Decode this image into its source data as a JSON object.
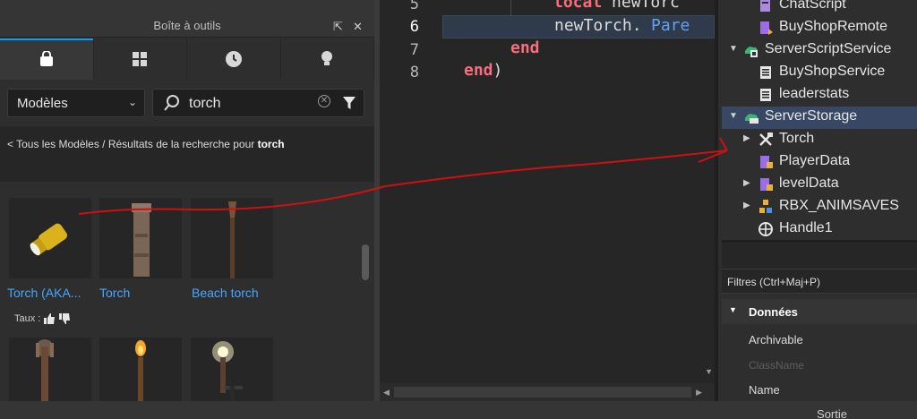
{
  "toolbox": {
    "title": "Boîte à outils",
    "dropdown_value": "Modèles",
    "search_value": "torch",
    "breadcrumb_prefix": "< Tous les Modèles / Résultats de la recherche pour ",
    "breadcrumb_query": "torch",
    "tabs": [
      {
        "name": "marketplace",
        "icon": "bag-icon",
        "active": true
      },
      {
        "name": "inventory",
        "icon": "grid-icon",
        "active": false
      },
      {
        "name": "recent",
        "icon": "clock-icon",
        "active": false
      },
      {
        "name": "creations",
        "icon": "lightbulb-icon",
        "active": false
      }
    ],
    "results": [
      {
        "name": "Torch (AKA..."
      },
      {
        "name": "Torch"
      },
      {
        "name": "Beach torch"
      }
    ],
    "rating_label": "Taux :"
  },
  "editor": {
    "lines": [
      {
        "num": "5"
      },
      {
        "num": "6"
      },
      {
        "num": "7"
      },
      {
        "num": "8"
      }
    ],
    "code": {
      "l5_kw": "local",
      "l5_rest": " newTorc",
      "l6_a": "newTorch.",
      "l6_b": "Pare",
      "l7_kw": "end",
      "l8_kw": "end",
      "l8_rest": ")"
    }
  },
  "explorer": {
    "nodes": [
      {
        "label": "ChatScript",
        "icon": "localscript-icon"
      },
      {
        "label": "BuyShopRemote",
        "icon": "remote-event-icon"
      },
      {
        "label": "ServerScriptService",
        "icon": "service-icon"
      },
      {
        "label": "BuyShopService",
        "icon": "script-icon"
      },
      {
        "label": "leaderstats",
        "icon": "script-icon"
      },
      {
        "label": "ServerStorage",
        "icon": "storage-icon",
        "selected": true
      },
      {
        "label": "Torch",
        "icon": "tool-icon"
      },
      {
        "label": "PlayerData",
        "icon": "module-icon"
      },
      {
        "label": "levelData",
        "icon": "module-icon"
      },
      {
        "label": "RBX_ANIMSAVES",
        "icon": "model-icon"
      },
      {
        "label": "Handle1",
        "icon": "part-icon"
      }
    ],
    "filter_text": "Filtres (Ctrl+Maj+P)",
    "category": "Données",
    "props": [
      "Archivable",
      "ClassName",
      "Name"
    ]
  },
  "status": {
    "output": "Sortie"
  },
  "colors": {
    "accent": "#00a2ff",
    "link": "#47a6ff",
    "keyword": "#f86d7c",
    "annotation": "#d01010"
  }
}
